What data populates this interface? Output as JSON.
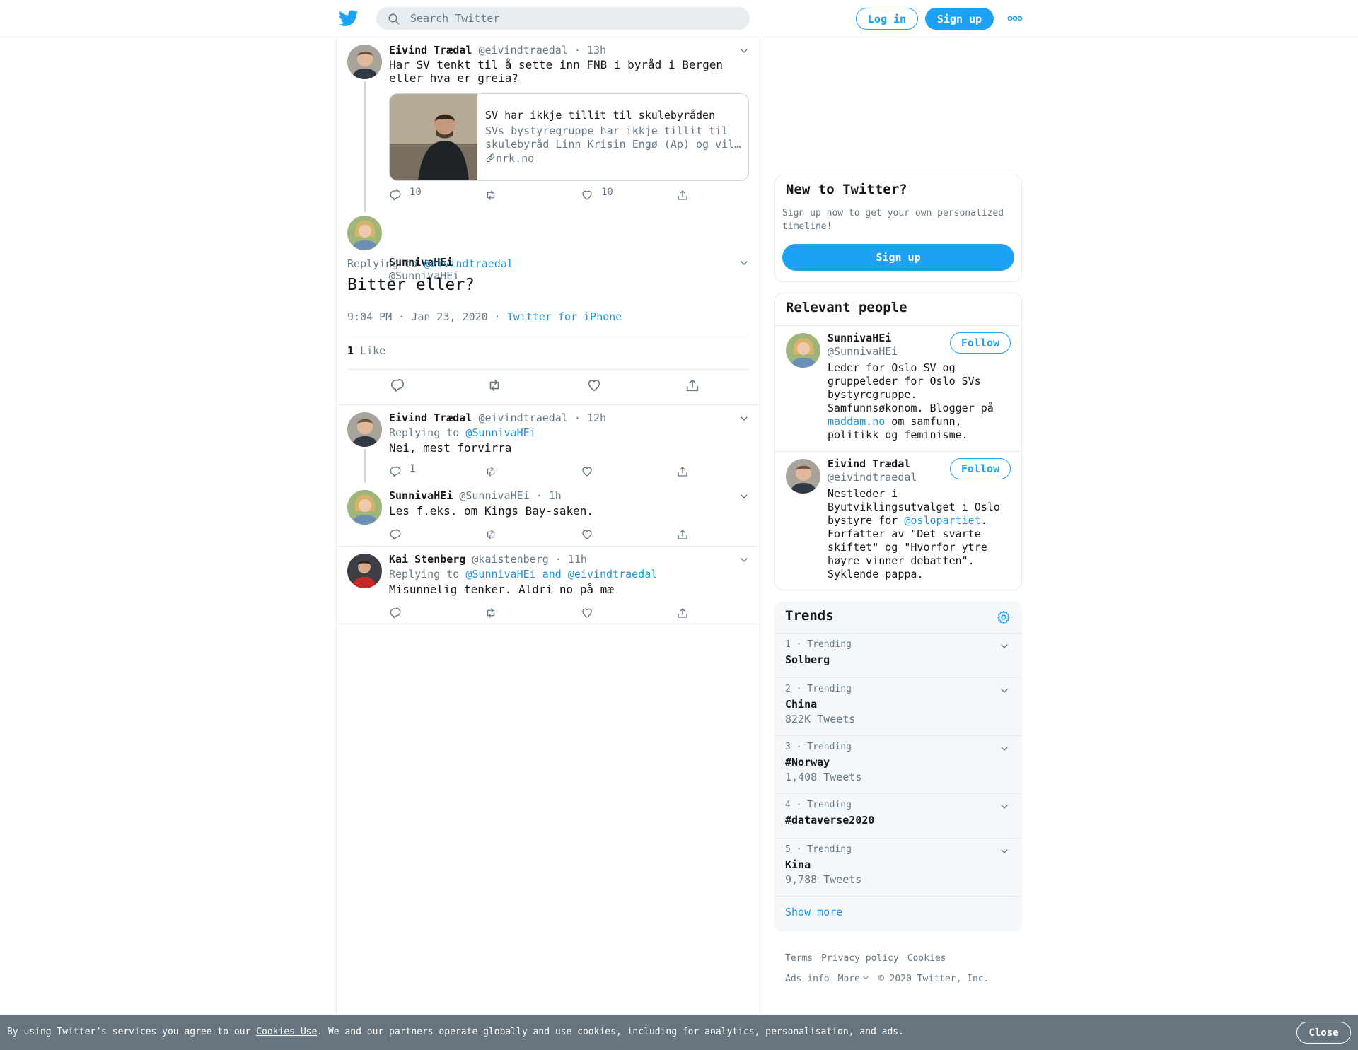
{
  "header": {
    "search_placeholder": "Search Twitter",
    "login_label": "Log in",
    "signup_label": "Sign up"
  },
  "thread": [
    {
      "name": "Eivind Trædal",
      "handle": "@eivindtraedal",
      "time": "· 13h",
      "text": "Har SV tenkt til å sette inn FNB i byråd i Bergen eller hva er greia?",
      "card": {
        "title": "SV har ikkje tillit til skulebyråden",
        "description": "SVs bystyregruppe har ikkje tillit til skulebyråd Linn Krisin Engø (Ap) og vil…",
        "url": "nrk.no"
      },
      "replies": "10",
      "likes": "10"
    }
  ],
  "focus": {
    "name": "SunnivaHEi",
    "handle": "@SunnivaHEi",
    "replying_prefix": "Replying to",
    "replying_to": "@eivindtraedal",
    "text": "Bitter eller?",
    "timestamp": "9:04 PM · Jan 23, 2020",
    "dot": "·",
    "source": "Twitter for iPhone",
    "like_count": "1",
    "like_label": "Like"
  },
  "replies": [
    {
      "name": "Eivind Trædal",
      "handle": "@eivindtraedal",
      "time": "· 12h",
      "replying_prefix": "Replying to",
      "replying_to": "@SunnivaHEi",
      "text": "Nei, mest forvirra",
      "reply_count": "1"
    },
    {
      "name": "SunnivaHEi",
      "handle": "@SunnivaHEi",
      "time": "· 1h",
      "text": "Les f.eks. om Kings Bay-saken."
    },
    {
      "name": "Kai Stenberg",
      "handle": "@kaistenberg",
      "time": "· 11h",
      "replying_prefix": "Replying to",
      "replying_to": "@SunnivaHEi and @eivindtraedal",
      "text": "Misunnelig tenker. Aldri no på mæ"
    }
  ],
  "sidebar": {
    "new_title": "New to Twitter?",
    "new_sub": "Sign up now to get your own personalized timeline!",
    "new_signup": "Sign up",
    "relevant_title": "Relevant people",
    "follow_label": "Follow",
    "people": [
      {
        "name": "SunnivaHEi",
        "handle": "@SunnivaHEi",
        "bio_a": "Leder for Oslo SV og gruppeleder for Oslo SVs bystyregruppe. Samfunnsøkonom. Blogger på ",
        "bio_link": "maddam.no",
        "bio_b": " om samfunn, politikk og feminisme."
      },
      {
        "name": "Eivind Trædal",
        "handle": "@eivindtraedal",
        "bio_a": "Nestleder i Byutviklingsutvalget i Oslo bystyre for ",
        "bio_link": "@oslopartiet",
        "bio_b": ". Forfatter av \"Det svarte skiftet\" og \"Hvorfor ytre høyre vinner debatten\". Syklende pappa."
      }
    ],
    "trends_title": "Trends",
    "trends": [
      {
        "label": "1 · Trending",
        "name": "Solberg",
        "count": ""
      },
      {
        "label": "2 · Trending",
        "name": "China",
        "count": "822K Tweets"
      },
      {
        "label": "3 · Trending",
        "name": "#Norway",
        "count": "1,408 Tweets"
      },
      {
        "label": "4 · Trending",
        "name": "#dataverse2020",
        "count": ""
      },
      {
        "label": "5 · Trending",
        "name": "Kina",
        "count": "9,788 Tweets"
      }
    ],
    "show_more": "Show more"
  },
  "footer": {
    "terms": "Terms",
    "privacy": "Privacy policy",
    "cookies": "Cookies",
    "ads": "Ads info",
    "more": "More",
    "copyright": "© 2020 Twitter, Inc."
  },
  "cookie_bar": {
    "text_a": "By using Twitter’s services you agree to our ",
    "link": "Cookies Use",
    "text_b": ". We and our partners operate globally and use cookies, including for analytics, personalisation, and ads.",
    "close": "Close"
  },
  "colors": {
    "brand": "#1da1f2",
    "link": "#1b95e0",
    "muted": "#657786",
    "cookie_bar": "#66757f"
  },
  "icons": [
    "twitter-bird-icon",
    "search-icon",
    "more-dots-icon",
    "chevron-down-icon",
    "reply-icon",
    "retweet-icon",
    "like-icon",
    "share-icon",
    "link-icon",
    "gear-icon"
  ]
}
